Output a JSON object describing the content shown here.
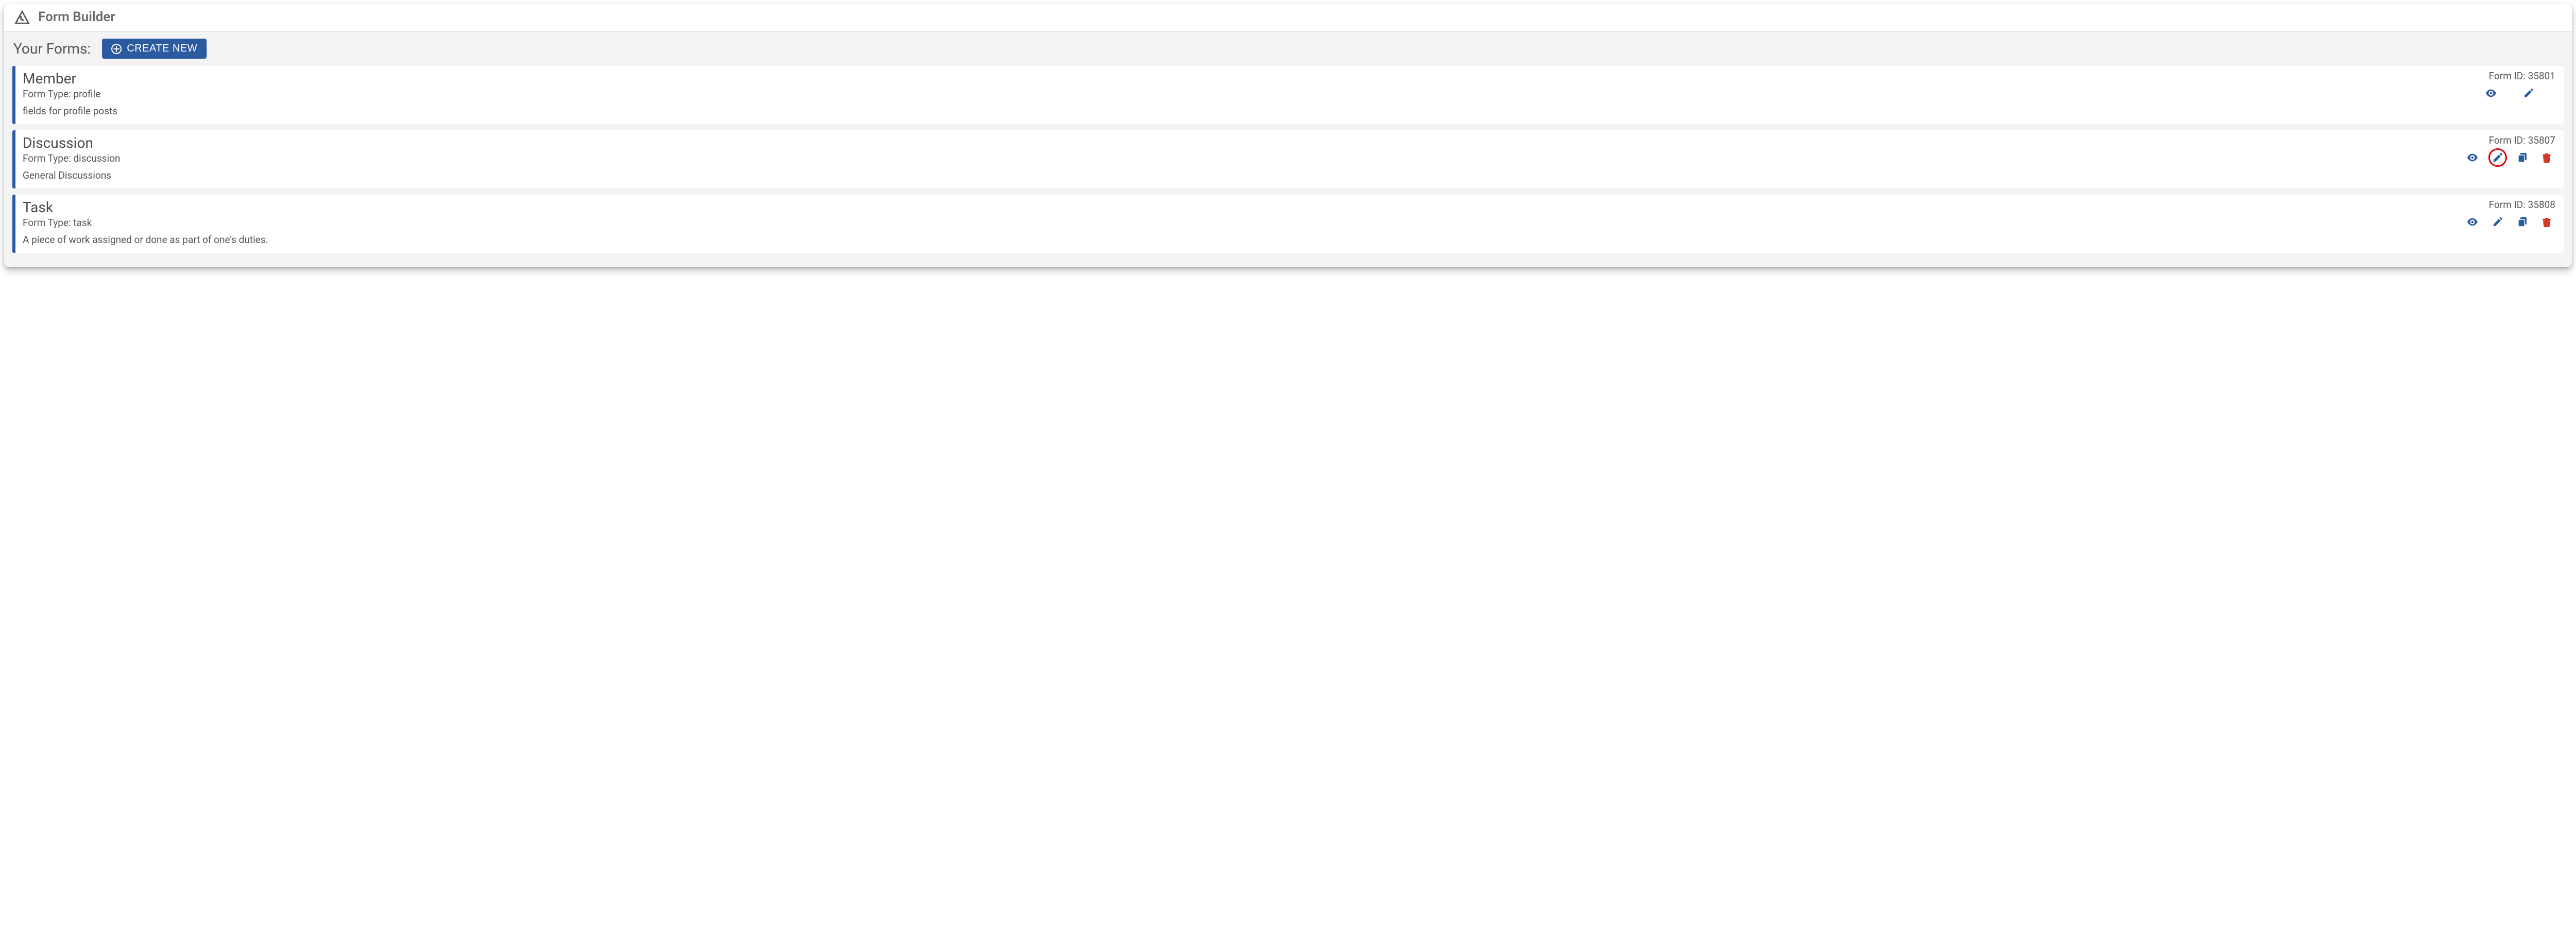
{
  "app": {
    "title": "Form Builder"
  },
  "subheader": {
    "label": "Your Forms:",
    "create_btn": "CREATE NEW"
  },
  "id_prefix": "Form ID: ",
  "type_prefix": "Form Type: ",
  "forms": [
    {
      "title": "Member",
      "type": "profile",
      "description": "fields for profile posts",
      "id": "35801",
      "actions": [
        "view",
        "edit"
      ],
      "highlight": null
    },
    {
      "title": "Discussion",
      "type": "discussion",
      "description": "General Discussions",
      "id": "35807",
      "actions": [
        "view",
        "edit",
        "copy",
        "delete"
      ],
      "highlight": "edit"
    },
    {
      "title": "Task",
      "type": "task",
      "description": "A piece of work assigned or done as part of one's duties.",
      "id": "35808",
      "actions": [
        "view",
        "edit",
        "copy",
        "delete"
      ],
      "highlight": null
    }
  ]
}
